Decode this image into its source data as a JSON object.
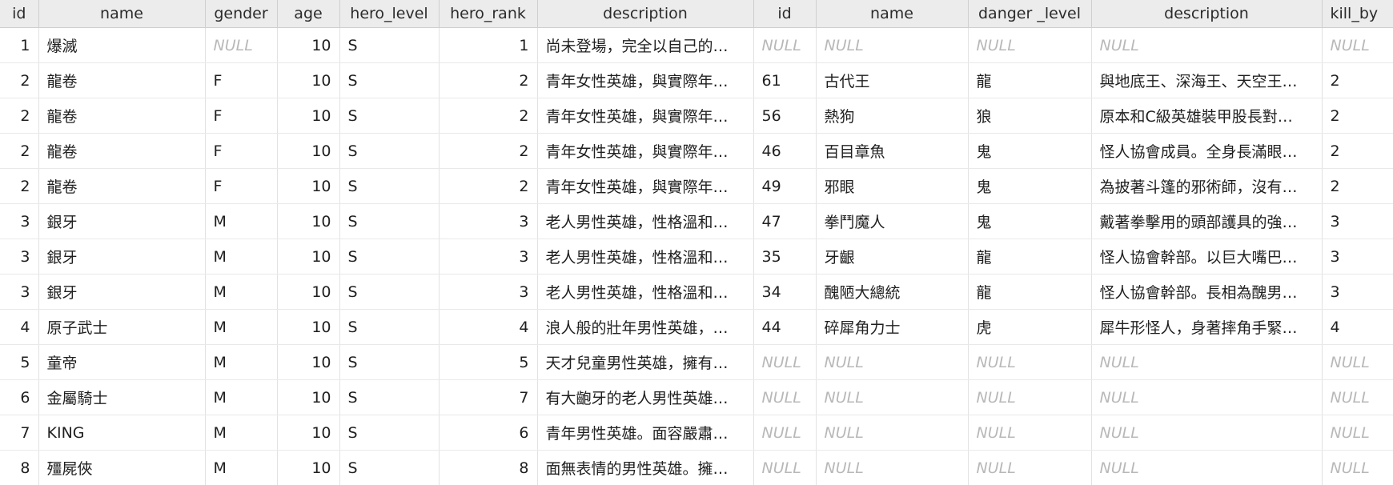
{
  "columns": [
    "id",
    "name",
    "gender",
    "age",
    "hero_level",
    "hero_rank",
    "description",
    "id",
    "name",
    "danger _level",
    "description",
    "kill_by"
  ],
  "rows": [
    [
      "1",
      "爆滅",
      "NULL",
      "10",
      "S",
      "1",
      "尚未登場，完全以自己的…",
      "NULL",
      "NULL",
      "NULL",
      "NULL",
      "NULL"
    ],
    [
      "2",
      "龍卷",
      "F",
      "10",
      "S",
      "2",
      "青年女性英雄，與實際年…",
      "61",
      "古代王",
      "龍",
      "與地底王、深海王、天空王…",
      "2"
    ],
    [
      "2",
      "龍卷",
      "F",
      "10",
      "S",
      "2",
      "青年女性英雄，與實際年…",
      "56",
      "熱狗",
      "狼",
      "原本和C級英雄裝甲股長對…",
      "2"
    ],
    [
      "2",
      "龍卷",
      "F",
      "10",
      "S",
      "2",
      "青年女性英雄，與實際年…",
      "46",
      "百目章魚",
      "鬼",
      "怪人協會成員。全身長滿眼…",
      "2"
    ],
    [
      "2",
      "龍卷",
      "F",
      "10",
      "S",
      "2",
      "青年女性英雄，與實際年…",
      "49",
      "邪眼",
      "鬼",
      "為披著斗篷的邪術師，沒有…",
      "2"
    ],
    [
      "3",
      "銀牙",
      "M",
      "10",
      "S",
      "3",
      "老人男性英雄，性格溫和…",
      "47",
      "拳鬥魔人",
      "鬼",
      "戴著拳擊用的頭部護具的強…",
      "3"
    ],
    [
      "3",
      "銀牙",
      "M",
      "10",
      "S",
      "3",
      "老人男性英雄，性格溫和…",
      "35",
      "牙齦",
      "龍",
      "怪人協會幹部。以巨大嘴巴…",
      "3"
    ],
    [
      "3",
      "銀牙",
      "M",
      "10",
      "S",
      "3",
      "老人男性英雄，性格溫和…",
      "34",
      "醜陋大總統",
      "龍",
      "怪人協會幹部。長相為醜男…",
      "3"
    ],
    [
      "4",
      "原子武士",
      "M",
      "10",
      "S",
      "4",
      "浪人般的壯年男性英雄，…",
      "44",
      "碎犀角力士",
      "虎",
      "犀牛形怪人，身著摔角手緊…",
      "4"
    ],
    [
      "5",
      "童帝",
      "M",
      "10",
      "S",
      "5",
      "天才兒童男性英雄，擁有…",
      "NULL",
      "NULL",
      "NULL",
      "NULL",
      "NULL"
    ],
    [
      "6",
      "金屬騎士",
      "M",
      "10",
      "S",
      "7",
      "有大齙牙的老人男性英雄…",
      "NULL",
      "NULL",
      "NULL",
      "NULL",
      "NULL"
    ],
    [
      "7",
      "KING",
      "M",
      "10",
      "S",
      "6",
      "青年男性英雄。面容嚴肅…",
      "NULL",
      "NULL",
      "NULL",
      "NULL",
      "NULL"
    ],
    [
      "8",
      "殭屍俠",
      "M",
      "10",
      "S",
      "8",
      "面無表情的男性英雄。擁…",
      "NULL",
      "NULL",
      "NULL",
      "NULL",
      "NULL"
    ]
  ]
}
